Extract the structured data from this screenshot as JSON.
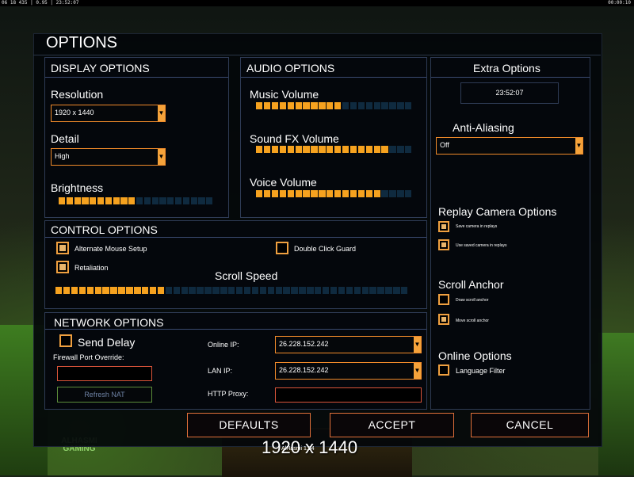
{
  "top_bar": {
    "left_text": "06 18 435 | 0.95 | 23:52:07",
    "right_text": "00:00:10"
  },
  "window": {
    "title": "OPTIONS"
  },
  "display": {
    "title": "DISPLAY OPTIONS",
    "resolution_label": "Resolution",
    "resolution_value": "1920 x 1440",
    "detail_label": "Detail",
    "detail_value": "High",
    "brightness_label": "Brightness",
    "brightness_level": 0.5
  },
  "audio": {
    "title": "AUDIO OPTIONS",
    "music_label": "Music Volume",
    "music_level": 0.55,
    "sfx_label": "Sound FX Volume",
    "sfx_level": 0.85,
    "voice_label": "Voice Volume",
    "voice_level": 0.8
  },
  "extra": {
    "title": "Extra Options",
    "clock": "23:52:07",
    "antialiasing_label": "Anti-Aliasing",
    "antialiasing_value": "Off",
    "replay_title": "Replay Camera Options",
    "save_camera_label": "Save camera in replays",
    "use_camera_label": "Use saved camera in replays",
    "scroll_anchor_title": "Scroll Anchor",
    "draw_anchor_label": "Draw scroll anchor",
    "move_anchor_label": "Move scroll anchor",
    "online_title": "Online Options",
    "language_filter_label": "Language Filter"
  },
  "control": {
    "title": "CONTROL OPTIONS",
    "alt_mouse_label": "Alternate Mouse Setup",
    "double_click_label": "Double Click Guard",
    "retaliation_label": "Retaliation",
    "scroll_speed_label": "Scroll Speed",
    "scroll_speed_level": 0.3
  },
  "network": {
    "title": "NETWORK OPTIONS",
    "send_delay_label": "Send Delay",
    "firewall_label": "Firewall Port Override:",
    "refresh_nat_label": "Refresh NAT",
    "online_ip_label": "Online IP:",
    "online_ip_value": "26.228.152.242",
    "lan_ip_label": "LAN IP:",
    "lan_ip_value": "26.228.152.242",
    "http_proxy_label": "HTTP Proxy:"
  },
  "buttons": {
    "defaults": "DEFAULTS",
    "accept": "ACCEPT",
    "cancel": "CANCEL"
  },
  "background": {
    "gaming_logo": "ALHASMI GAMING",
    "overlay_resolution": "1920 x 1440",
    "overlay_sub": "AlHasmi 1.94"
  },
  "colors": {
    "accent": "#f6a21f",
    "border": "#2e3b55",
    "button_border": "#e0703a"
  }
}
